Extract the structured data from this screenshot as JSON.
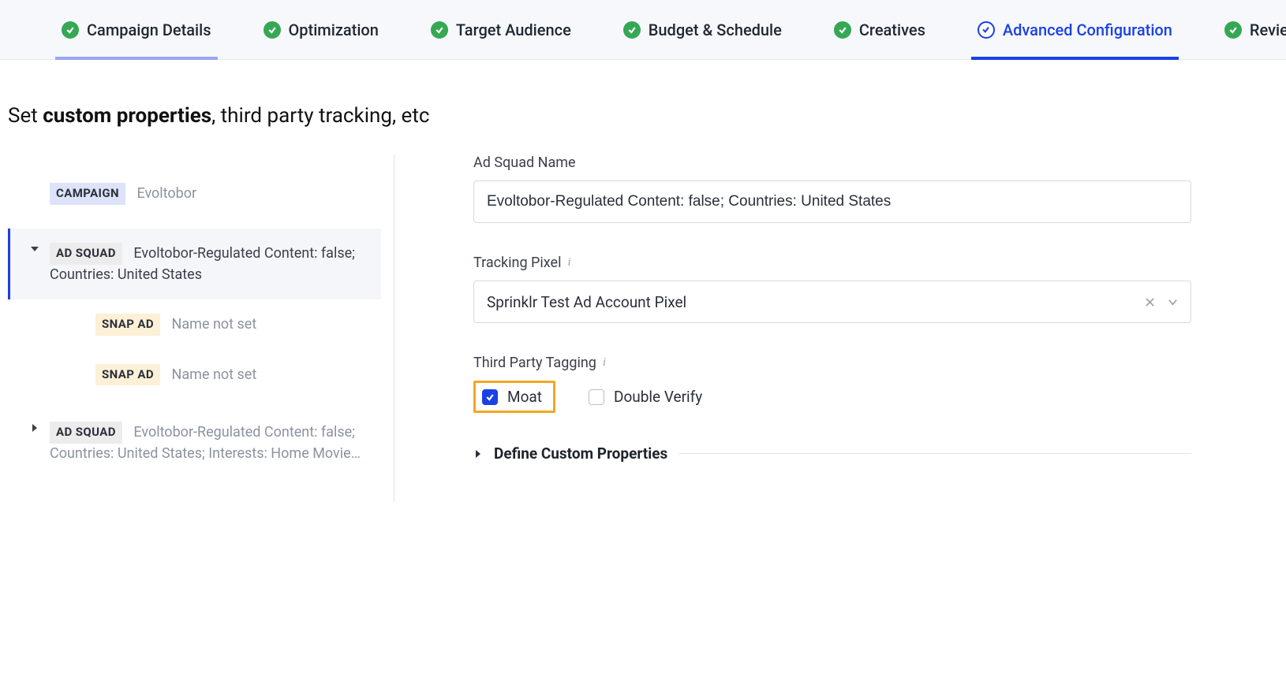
{
  "stepper": [
    {
      "label": "Campaign Details",
      "status": "done",
      "underline": "partial"
    },
    {
      "label": "Optimization",
      "status": "done",
      "underline": "none"
    },
    {
      "label": "Target Audience",
      "status": "done",
      "underline": "none"
    },
    {
      "label": "Budget & Schedule",
      "status": "done",
      "underline": "none"
    },
    {
      "label": "Creatives",
      "status": "done",
      "underline": "none"
    },
    {
      "label": "Advanced Configuration",
      "status": "current",
      "underline": "active"
    },
    {
      "label": "Review",
      "status": "done",
      "underline": "none"
    }
  ],
  "heading": {
    "prefix": "Set ",
    "strong": "custom properties",
    "suffix": ", third party tracking, etc"
  },
  "tree": {
    "campaign": {
      "tag": "CAMPAIGN",
      "name": "Evoltobor"
    },
    "adsquads": [
      {
        "tag": "AD SQUAD",
        "name": "Evoltobor-Regulated Content: false; Countries: United States",
        "expanded": true,
        "selected": true,
        "ads": [
          {
            "tag": "SNAP AD",
            "name": "Name not set"
          },
          {
            "tag": "SNAP AD",
            "name": "Name not set"
          }
        ]
      },
      {
        "tag": "AD SQUAD",
        "name": "Evoltobor-Regulated Content: false; Countries: United States; Interests: Home Movie…",
        "expanded": false,
        "selected": false,
        "ads": []
      }
    ]
  },
  "form": {
    "ad_squad_name": {
      "label": "Ad Squad Name",
      "value": "Evoltobor-Regulated Content: false; Countries: United States"
    },
    "tracking_pixel": {
      "label": "Tracking Pixel",
      "value": "Sprinklr Test Ad Account Pixel"
    },
    "third_party_tagging": {
      "label": "Third Party Tagging",
      "options": [
        {
          "label": "Moat",
          "checked": true,
          "highlighted": true
        },
        {
          "label": "Double Verify",
          "checked": false,
          "highlighted": false
        }
      ]
    },
    "custom_properties_header": "Define Custom Properties"
  }
}
